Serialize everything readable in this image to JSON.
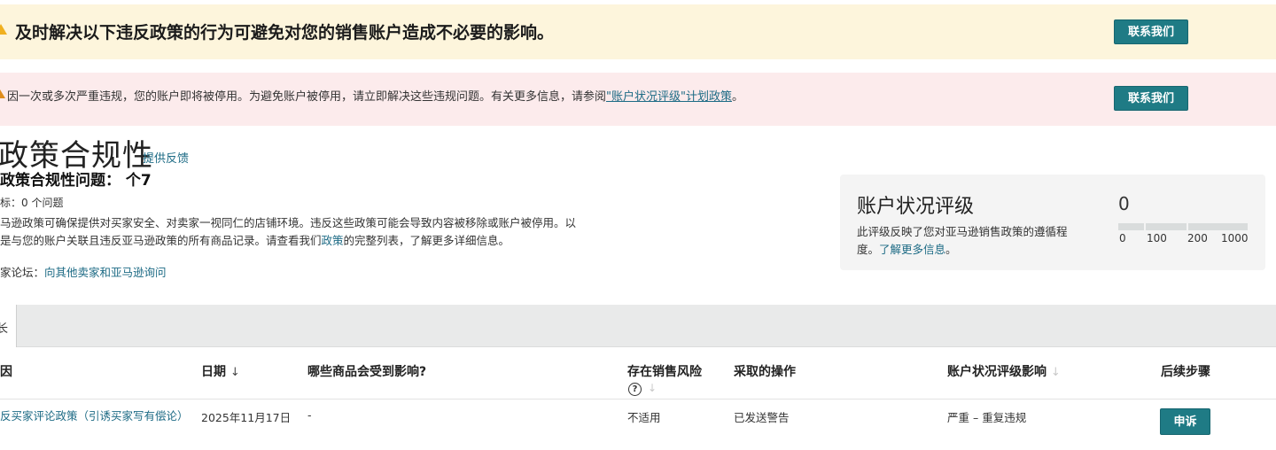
{
  "alerts": {
    "top": {
      "title": "及时解决以下违反政策的行为可避免对您的销售账户造成不必要的影响。",
      "button": "联系我们"
    },
    "suspension": {
      "message_before": "因一次或多次严重违规，您的账户即将被停用。为避免账户被停用，请立即解决这些违规问题。有关更多信息，请参阅",
      "link": "\"账户状况评级\"计划政策",
      "message_after": "。",
      "button": "联系我们"
    }
  },
  "page": {
    "title": "政策合规性",
    "feedback_link": "提供反馈",
    "issues_heading": "政策合规性问题：  个7",
    "target": "标：0 个问题",
    "description_part1": "马逊政策可确保提供对买家安全、对卖家一视同仁的店铺环境。违反这些政策可能会导致内容被移除或账户被停用。以",
    "description_part2": "是与您的账户关联且违反亚马逊政策的所有商品记录。请查看我们",
    "description_link": "政策",
    "description_part3": "的完整列表，了解更多详细信息。",
    "forum_label": "家论坛：",
    "forum_link": "向其他卖家和亚马逊询问"
  },
  "account_health": {
    "title": "账户状况评级",
    "description": "此评级反映了您对亚马逊销售政策的遵循程度。",
    "learn_more": "了解更多信息",
    "description_end": "。",
    "score": "0",
    "scale_ticks": [
      "0",
      "100",
      "200",
      "1000"
    ]
  },
  "tabs": {
    "active_label": "长"
  },
  "table": {
    "headers": {
      "reason": "因",
      "date": "日期",
      "affected": "哪些商品会受到影响?",
      "sales_risk": "存在销售风险",
      "action": "采取的操作",
      "ahr_impact": "账户状况评级影响",
      "next_steps": "后续步骤"
    },
    "sort_down_symbol": "↓",
    "rows": [
      {
        "reason": "反买家评论政策（引诱买家写有偿论）",
        "date": "2025年11月17日",
        "affected": "-",
        "sales_risk": "不适用",
        "action": "已发送警告",
        "ahr_impact": "严重 – 重复违规",
        "next_step_button": "申诉"
      }
    ]
  },
  "colors": {
    "accent": "#1f7b85",
    "link": "#1d6b85",
    "yellow_banner": "#fdf5dc",
    "pink_banner": "#fcebec"
  }
}
